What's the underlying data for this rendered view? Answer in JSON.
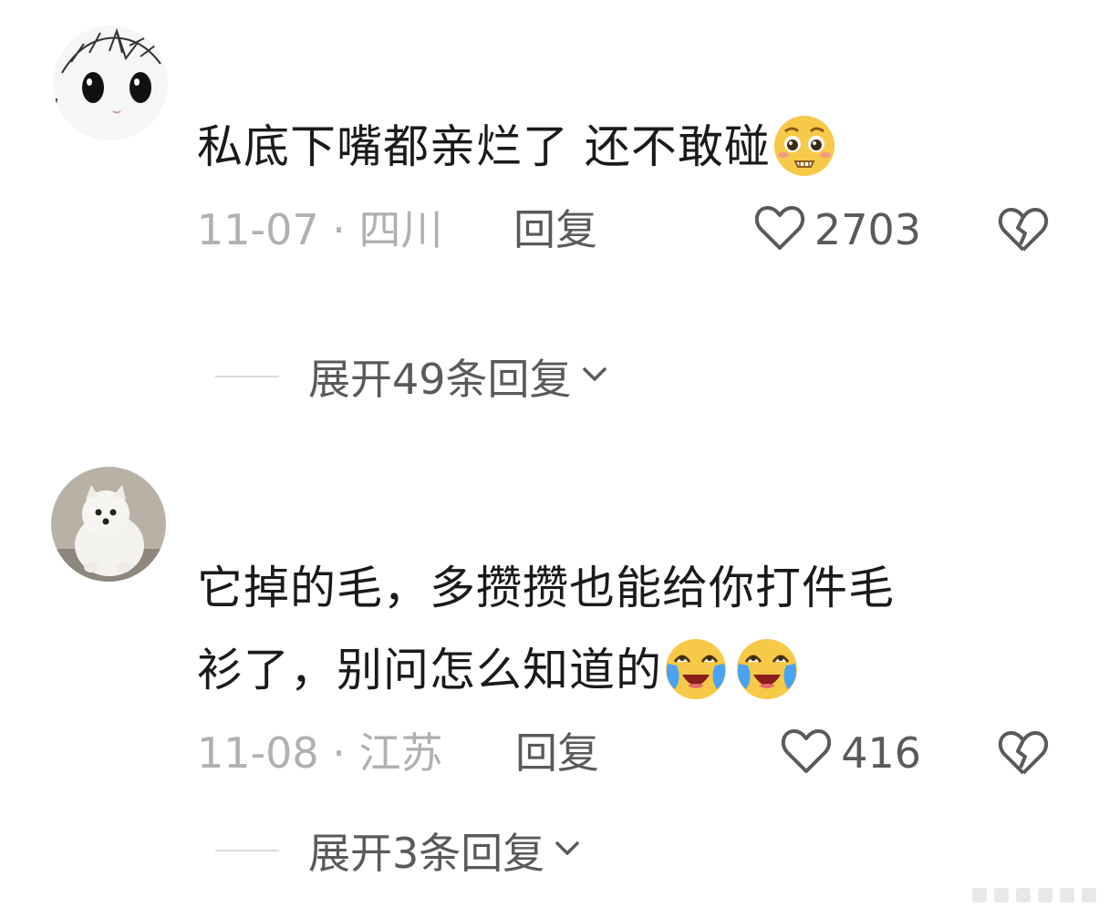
{
  "comments": [
    {
      "text": "私底下嘴都亲烂了  还不敢碰",
      "emoji": "pleading-face-emoji",
      "date": "11-07",
      "location": "四川",
      "reply_label": "回复",
      "likes": "2703",
      "expand_label": "展开49条回复"
    },
    {
      "text_line1": "它掉的毛，多攒攒也能给你打件毛",
      "text_line2": "衫了，别问怎么知道的",
      "emoji": "crying-laughing-emoji",
      "date": "11-08",
      "location": "江苏",
      "reply_label": "回复",
      "likes": "416",
      "expand_label": "展开3条回复"
    }
  ],
  "separator": " · ",
  "icons": {
    "like": "heart-outline-icon",
    "dislike": "broken-heart-icon",
    "expand": "chevron-down-icon"
  }
}
